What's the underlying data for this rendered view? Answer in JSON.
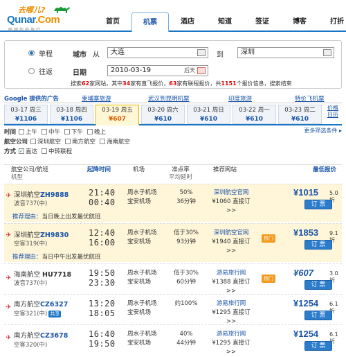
{
  "brand": {
    "slogan": "去哪儿?",
    "name_a": "Qunar",
    "name_b": ".Com",
    "sub": "聪明你的旅行"
  },
  "nav": [
    "首页",
    "机票",
    "酒店",
    "知道",
    "签证",
    "博客",
    "打折"
  ],
  "search": {
    "trip_oneway": "单程",
    "trip_round": "往返",
    "city_label": "城市",
    "from_label": "从",
    "from_value": "大连",
    "to_label": "到",
    "to_value": "深圳",
    "date_label": "日期",
    "date_value": "2010-03-19",
    "date_suffix": "后天",
    "note_a": "搜索",
    "note_sites": "62",
    "note_b": "家网站，其中",
    "note_direct": "34",
    "note_c": "家有直飞报价，",
    "note_conn": "63",
    "note_d": "家有联程报价，共",
    "note_total": "1151",
    "note_e": "个报价信息，搜索结束"
  },
  "ads": {
    "google": "Google 提供的广告",
    "links": [
      "東埔寨旅游",
      "武汉到昆明机票",
      "印度旅游",
      "特价飞机票"
    ]
  },
  "dates": [
    {
      "d": "03-17 周三",
      "p": "¥1106"
    },
    {
      "d": "03-18 周四",
      "p": "¥1106"
    },
    {
      "d": "03-19 周五",
      "p": "¥607"
    },
    {
      "d": "03-20 周六",
      "p": "¥610"
    },
    {
      "d": "03-21 周日",
      "p": "¥610"
    },
    {
      "d": "03-22 周一",
      "p": "¥610"
    },
    {
      "d": "03-23 周二",
      "p": "¥610"
    }
  ],
  "date_more": [
    "价格",
    "日历"
  ],
  "filters": {
    "time_label": "时间",
    "time_opts": [
      "上午",
      "中午",
      "下午",
      "晚上"
    ],
    "airline_label": "航空公司",
    "airline_opts": [
      "深圳航空",
      "南方航空",
      "海南航空"
    ],
    "mode_label": "方式",
    "mode_opts": [
      "直达",
      "中转联程"
    ],
    "more": "更多筛选条件 ▸"
  },
  "thead": {
    "airline": "航空公司/航班",
    "plane": "机型",
    "depart": "起降时间",
    "airport": "机场",
    "ontime": "准点率",
    "delay": "平均延时",
    "site": "推荐网站",
    "price": "最低报价"
  },
  "flights": [
    {
      "airline": "深圳航空",
      "fn": "ZH9888",
      "plane": "波音737(中)",
      "dep": "21:40",
      "arr": "00:40",
      "ap1": "周水子机场",
      "ap2": "宝安机场",
      "ot1": "50%",
      "ot2": "36分钟",
      "site": "深圳航空官网",
      "site2": "¥1060 直接订>>",
      "price": "¥1015",
      "disc": "5.0折",
      "buy": "订 票",
      "reason_k": "推荐理由：",
      "reason": "当日晚上出发最优航班"
    },
    {
      "airline": "深圳航空",
      "fn": "ZH9830",
      "plane": "空客319(中)",
      "dep": "12:40",
      "arr": "16:00",
      "ap1": "周水子机场",
      "ap2": "宝安机场",
      "ot1": "低于30%",
      "ot2": "93分钟",
      "site": "深圳航空官网",
      "site2": "¥1940 直接订>>",
      "hot": "热门",
      "price": "¥1853",
      "disc": "9.1折",
      "buy": "订 票",
      "reason_k": "推荐理由：",
      "reason": "当日中午出发最优航班"
    },
    {
      "airline": "海南航空",
      "fn": "HU7718",
      "plane": "波音737(中)",
      "dep": "19:50",
      "arr": "23:30",
      "ap1": "周水子机场",
      "ap2": "宝安机场",
      "ot1": "低于30%",
      "ot2": "60分钟",
      "site": "游易旅行网",
      "site2": "¥1388 直接订>>",
      "hot": "热门",
      "price": "¥607",
      "disc": "3.0折",
      "buy": "订 票"
    },
    {
      "airline": "南方航空",
      "fn": "CZ6327",
      "plane": "空客321(中)",
      "share": "共享",
      "dep": "13:20",
      "arr": "18:05",
      "ap1": "周水子机场",
      "ap2": "宝安机场",
      "ot1": "约100%",
      "ot2": "",
      "site": "游易旅行网",
      "site2": "¥1295 直接订>>",
      "price": "¥1254",
      "disc": "6.1折",
      "buy": "订 票"
    },
    {
      "airline": "南方航空",
      "fn": "CZ3678",
      "plane": "空客320(中)",
      "dep": "16:40",
      "arr": "19:50",
      "ap1": "周水子机场",
      "ap2": "宝安机场",
      "ot1": "40%",
      "ot2": "44分钟",
      "site": "游易旅行网",
      "site2": "¥1295 直接订>>",
      "price": "¥1254",
      "disc": "6.1折",
      "buy": "订 票"
    }
  ]
}
